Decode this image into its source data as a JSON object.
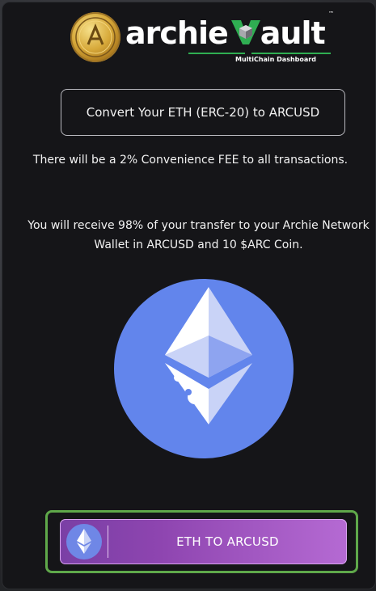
{
  "header": {
    "brand_prefix": "archie",
    "brand_suffix": "ault",
    "trademark": "™",
    "subtitle": "MultiChain Dashboard",
    "coin_icon": "archie-gold-coin-icon",
    "vault_mark_icon": "green-v-cube-icon"
  },
  "convert": {
    "label": "Convert Your ETH (ERC-20) to ARCUSD"
  },
  "info": {
    "fee": "There will be a 2% Convenience FEE to all transactions.",
    "receive_line1": "You will receive 98% of your transfer to your Archie Network",
    "receive_line2": "Wallet in ARCUSD and 10 $ARC Coin."
  },
  "eth_graphic": {
    "icon": "ethereum-logo-icon",
    "color": "#6285ec"
  },
  "swap_button": {
    "label": "ETH TO ARCUSD",
    "icon": "ethereum-logo-icon"
  },
  "colors": {
    "accent_green": "#5fa84a",
    "button_purple_start": "#7a3fa5",
    "button_purple_end": "#b56ad3",
    "background": "#151518"
  }
}
